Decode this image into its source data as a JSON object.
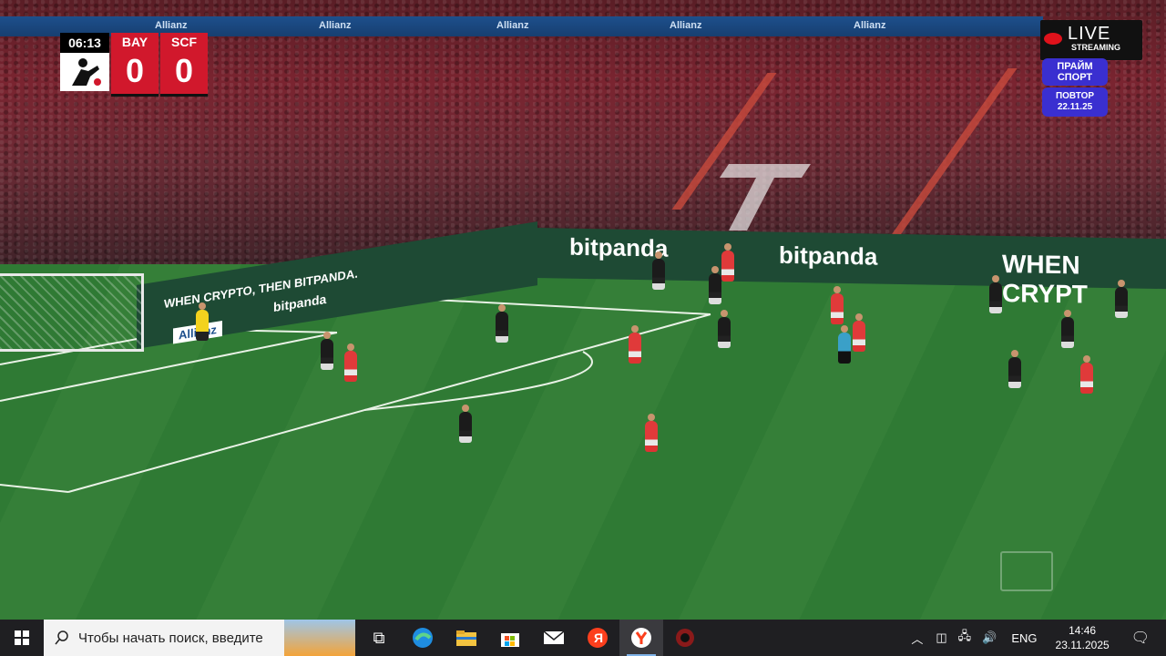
{
  "broadcast": {
    "match_clock": "06:13",
    "home": {
      "abbr": "BAY",
      "score": "0",
      "color": "#d1182c"
    },
    "away": {
      "abbr": "SCF",
      "score": "0",
      "color": "#d1182c"
    },
    "live_badge": {
      "line1": "LIVE",
      "line2": "STREAMING"
    },
    "channel": {
      "line1": "ПРАЙМ",
      "line2": "СПОРТ"
    },
    "replay": {
      "label": "ПОВТОР",
      "date": "22.11.25"
    },
    "stadium_signage": {
      "roof": [
        "Allianz",
        "Allianz",
        "Allianz",
        "Allianz",
        "Allianz"
      ],
      "boards_right": [
        "bitpanda",
        "bitpanda",
        "WHEN CRYPT"
      ],
      "boards_left": [
        "WHEN CRYPTO, THEN BITPANDA.",
        "bitpanda",
        "Allianz"
      ]
    }
  },
  "taskbar": {
    "search_placeholder": "Чтобы начать поиск, введите",
    "pinned_apps": [
      "task-view",
      "edge",
      "file-explorer",
      "microsoft-store",
      "mail",
      "yandex",
      "yandex-browser",
      "app-red"
    ],
    "language": "ENG",
    "time": "14:46",
    "date": "23.11.2025"
  },
  "colors": {
    "taskbar": "#1f1f22",
    "pitch": "#2f7a34",
    "live_red": "#e0121b",
    "channel_purple": "#3a2fd0"
  }
}
